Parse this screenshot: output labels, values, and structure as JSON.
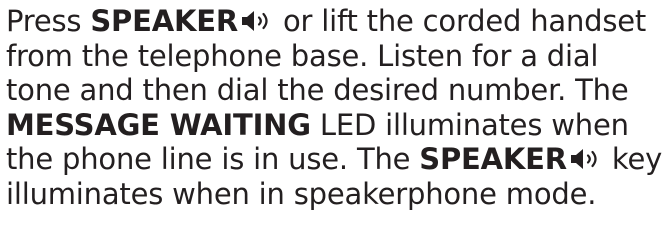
{
  "instruction": {
    "line1": {
      "before": "Press ",
      "key": "SPEAKER",
      "icon": "speaker-volume-icon",
      "after": " or lift the corded handset"
    },
    "line2": "from the telephone base. Listen for a dial",
    "line3": "tone and then dial the desired number. The",
    "line4": {
      "key": "MESSAGE WAITING",
      "after": " LED illuminates when"
    },
    "line5": {
      "before": "the phone line is in use. The ",
      "key": "SPEAKER",
      "icon": "speaker-volume-icon",
      "after": " key"
    },
    "line6": "illuminates when in speakerphone mode."
  },
  "colors": {
    "text": "#231f20",
    "background": "#ffffff"
  }
}
